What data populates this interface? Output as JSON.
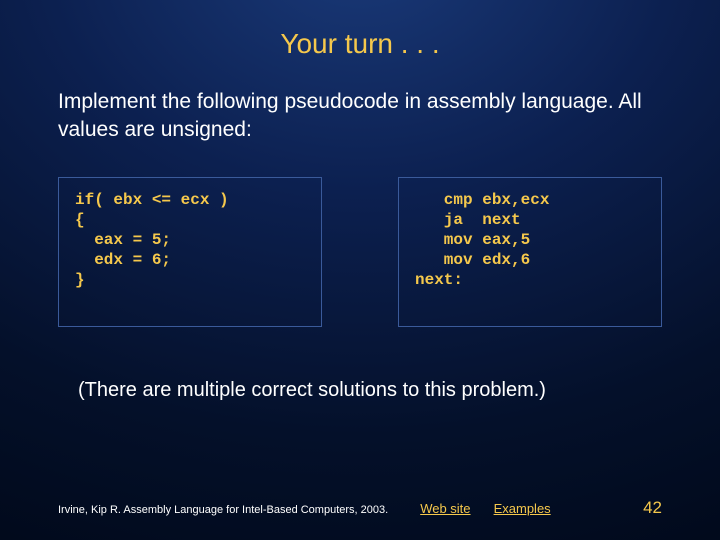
{
  "title": "Your turn . . .",
  "intro": "Implement the following pseudocode in assembly language. All values are unsigned:",
  "code_left": "if( ebx <= ecx )\n{\n  eax = 5;\n  edx = 6;\n}",
  "code_right": "   cmp ebx,ecx\n   ja  next\n   mov eax,5\n   mov edx,6\nnext:",
  "note": "(There are multiple correct solutions to this problem.)",
  "footer": {
    "cite": "Irvine, Kip R. Assembly Language for Intel-Based Computers, 2003.",
    "link1": "Web site",
    "link2": "Examples",
    "page": "42"
  }
}
